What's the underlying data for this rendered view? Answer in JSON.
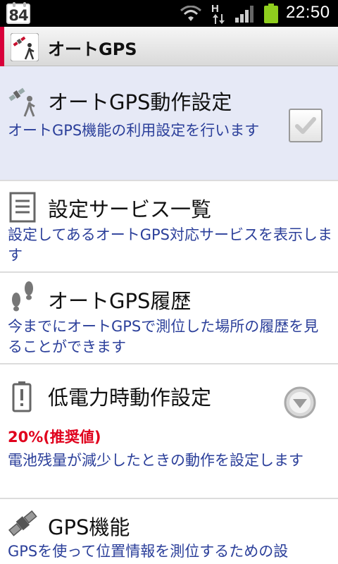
{
  "status_bar": {
    "calendar_day": "84",
    "network_type": "H",
    "time": "22:50",
    "icons": [
      "calendar-icon",
      "wifi-icon",
      "data-arrows-icon",
      "signal-icon",
      "battery-icon"
    ]
  },
  "header": {
    "title": "オートGPS",
    "accent_color": "#d8003a",
    "icon": "auto-gps-app-icon"
  },
  "settings": [
    {
      "title": "オートGPS動作設定",
      "summary": "オートGPS機能の利用設定を行います",
      "icon": "satellite-person-icon",
      "control": "checkbox",
      "checked": true
    },
    {
      "title": "設定サービス一覧",
      "summary": "設定してあるオートGPS対応サービスを表示します",
      "icon": "list-document-icon"
    },
    {
      "title": "オートGPS履歴",
      "summary": "今までにオートGPSで測位した場所の履歴を見ることができます",
      "icon": "footprints-icon"
    },
    {
      "title": "低電力時動作設定",
      "value": "20%(推奨値)",
      "summary": "電池残量が減少したときの動作を設定します",
      "icon": "low-battery-icon",
      "control": "dropdown"
    },
    {
      "title": "GPS機能",
      "summary": "GPSを使って位置情報を測位するための設",
      "icon": "satellite-icon"
    }
  ],
  "colors": {
    "highlight_bg": "#e6e9f6",
    "summary_text": "#2b3f9a",
    "value_text": "#e0001c"
  }
}
